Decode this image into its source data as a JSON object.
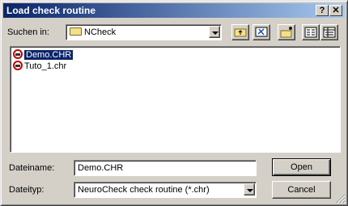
{
  "window": {
    "title": "Load check routine",
    "help_label": "?",
    "close_label": "✕"
  },
  "lookin": {
    "label": "Suchen in:",
    "value": "NCheck"
  },
  "toolbar": {
    "up_icon": "up-folder-icon",
    "desktop_icon": "desktop-icon",
    "newfolder_icon": "new-folder-icon",
    "list_icon": "list-view-icon",
    "details_icon": "details-view-icon"
  },
  "files": [
    {
      "name": "Demo.CHR",
      "selected": true
    },
    {
      "name": "Tuto_1.chr",
      "selected": false
    }
  ],
  "filename": {
    "label": "Dateiname:",
    "value": "Demo.CHR"
  },
  "filetype": {
    "label": "Dateityp:",
    "value": "NeuroCheck check routine (*.chr)"
  },
  "buttons": {
    "open": "Open",
    "cancel": "Cancel"
  }
}
